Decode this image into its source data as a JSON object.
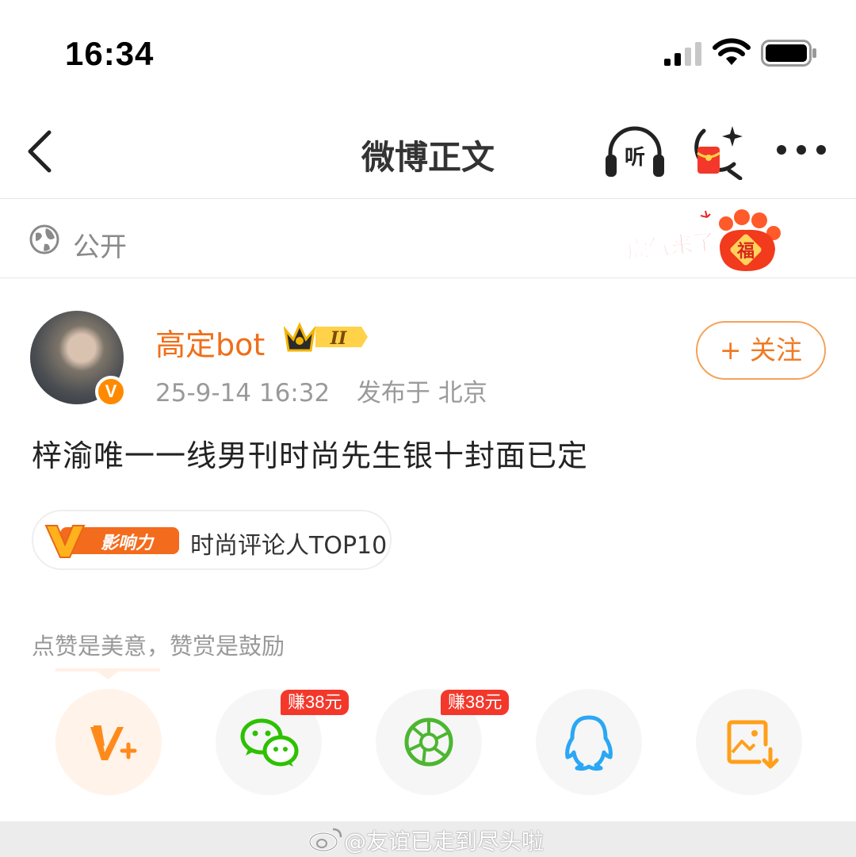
{
  "status_bar": {
    "time": "16:34"
  },
  "nav": {
    "title": "微博正文",
    "listen_label": "听"
  },
  "privacy": {
    "label": "公开",
    "badge_text": "虎气来了",
    "badge_fu": "福"
  },
  "post": {
    "username": "高定bot",
    "vip_level": "II",
    "time": "25-9-14 16:32",
    "location": "发布于 北京",
    "follow_label": "+ 关注",
    "text": "梓渝唯一一线男刊时尚先生银十封面已定",
    "avatar_badge": "V"
  },
  "influence": {
    "logo_text": "影响力",
    "label": "时尚评论人TOP10"
  },
  "reward": {
    "hint": "点赞是美意，赞赏是鼓励"
  },
  "share": {
    "buttons": [
      {
        "icon": "reward-v-plus-icon"
      },
      {
        "icon": "wechat-icon",
        "badge": "赚38元"
      },
      {
        "icon": "moments-icon",
        "badge": "赚38元"
      },
      {
        "icon": "qq-icon"
      },
      {
        "icon": "save-image-icon"
      }
    ]
  },
  "watermark": {
    "text": "@友谊已走到尽头啦"
  },
  "colors": {
    "accent": "#f06e17",
    "badge_red": "#f3382b",
    "wechat_green": "#2dc100",
    "qq_blue": "#2aa7f5",
    "save_orange": "#ff9f1a"
  }
}
